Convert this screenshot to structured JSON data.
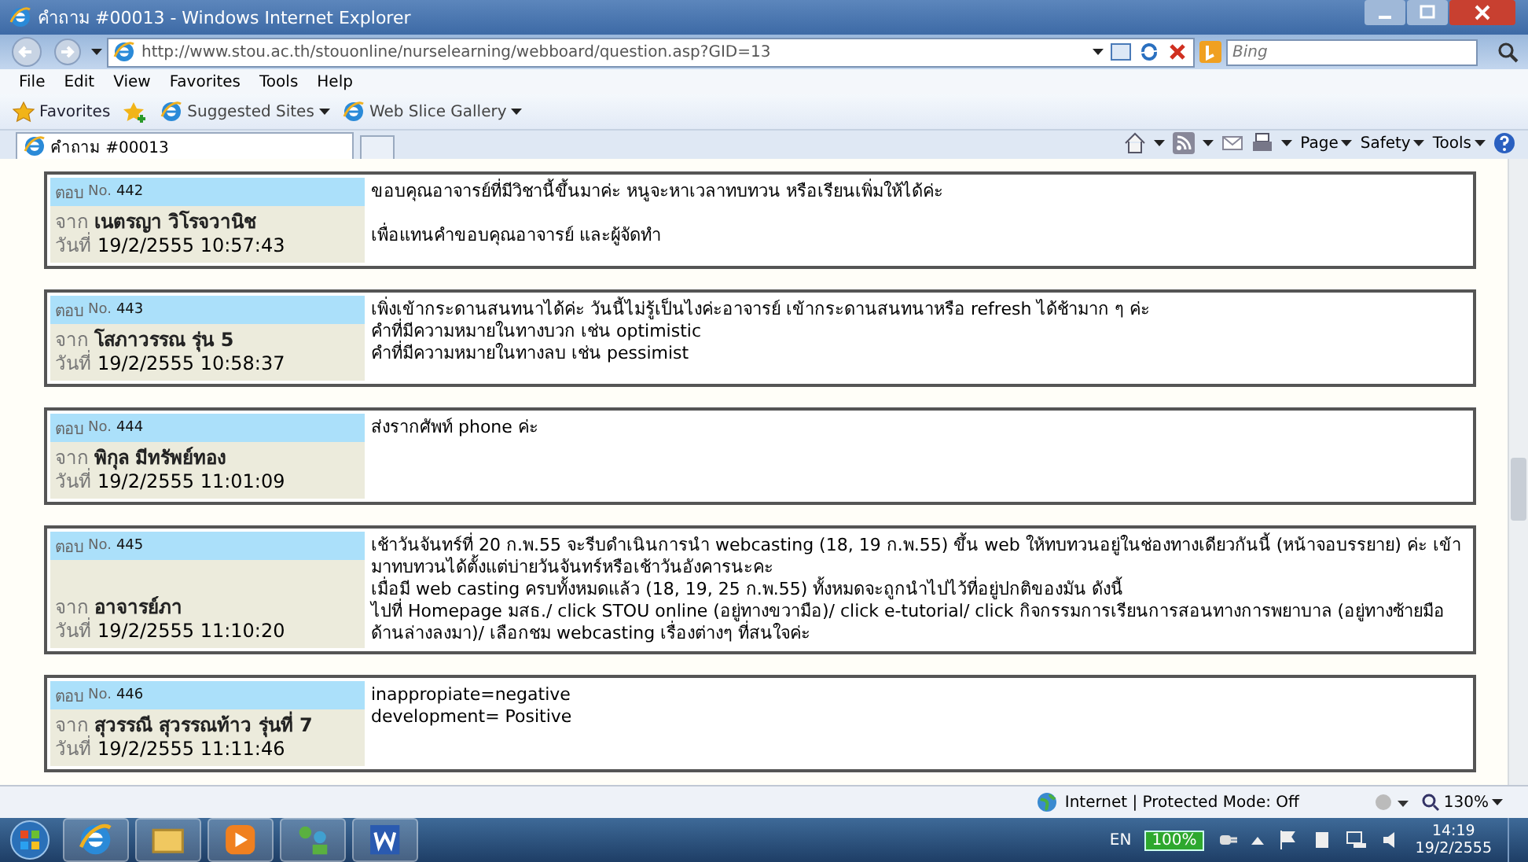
{
  "window": {
    "title": "คำถาม #00013 - Windows Internet Explorer"
  },
  "address_bar": {
    "url": "http://www.stou.ac.th/stouonline/nurselearning/webboard/question.asp?GID=13",
    "search_placeholder": "Bing"
  },
  "menu": [
    "File",
    "Edit",
    "View",
    "Favorites",
    "Tools",
    "Help"
  ],
  "favorites_bar": [
    {
      "label": "Favorites",
      "kind": "star"
    },
    {
      "label": "Suggested Sites",
      "kind": "dropdown"
    },
    {
      "label": "Web Slice Gallery",
      "kind": "dropdown"
    }
  ],
  "tabs": [
    {
      "label": "คำถาม #00013",
      "selected": true
    }
  ],
  "command_bar": [
    "Page",
    "Safety",
    "Tools"
  ],
  "posts": [
    {
      "reply_label": "ตอบ",
      "no_label": "No.",
      "number": "442",
      "from_label": "จาก",
      "author": "เนตรญา วิโรจวานิช",
      "date_label": "วันที่",
      "date": "19/2/2555 10:57:43",
      "spaced": true,
      "lines": [
        "ขอบคุณอาจารย์ที่มีวิชานี้ขึ้นมาค่ะ หนูจะหาเวลาทบทวน หรือเรียนเพิ่มให้ได้ค่ะ",
        "เพื่อแทนคำขอบคุณอาจารย์ และผู้จัดทำ"
      ]
    },
    {
      "reply_label": "ตอบ",
      "no_label": "No.",
      "number": "443",
      "from_label": "จาก",
      "author": "โสภาวรรณ รุ่น 5",
      "date_label": "วันที่",
      "date": "19/2/2555 10:58:37",
      "lines": [
        "เพิ่งเข้ากระดานสนทนาได้ค่ะ วันนี้ไม่รู้เป็นไงค่ะอาจารย์ เข้ากระดานสนทนาหรือ refresh ได้ช้ามาก ๆ ค่ะ",
        "คำที่มีความหมายในทางบวก เช่น optimistic",
        "คำที่มีความหมายในทางลบ เช่น pessimist"
      ]
    },
    {
      "reply_label": "ตอบ",
      "no_label": "No.",
      "number": "444",
      "from_label": "จาก",
      "author": "พิกุล มีทรัพย์ทอง",
      "date_label": "วันที่",
      "date": "19/2/2555 11:01:09",
      "lines": [
        "ส่งรากศัพท์ phone ค่ะ"
      ]
    },
    {
      "reply_label": "ตอบ",
      "no_label": "No.",
      "number": "445",
      "from_label": "จาก",
      "author": "อาจารย์ภา",
      "date_label": "วันที่",
      "date": "19/2/2555 11:10:20",
      "lines": [
        "เช้าวันจันทร์ที่ 20 ก.พ.55 จะรีบดำเนินการนำ webcasting (18, 19 ก.พ.55) ขึ้น web ให้ทบทวนอยู่ในช่องทางเดียวกันนี้ (หน้าจอบรรยาย) ค่ะ เข้ามาทบทวนได้ตั้งแต่บ่ายวันจันทร์หรือเช้าวันอังคารนะคะ",
        "เมื่อมี web casting ครบทั้งหมดแล้ว (18, 19, 25 ก.พ.55) ทั้งหมดจะถูกนำไปไว้ที่อยู่ปกติของมัน ดังนี้",
        "ไปที่ Homepage มสธ./ click STOU online (อยู่ทางขวามือ)/ click e-tutorial/ click กิจกรรมการเรียนการสอนทางการพยาบาล (อยู่ทางซ้ายมือด้านล่างลงมา)/ เลือกชม webcasting เรื่องต่างๆ ที่สนใจค่ะ"
      ]
    },
    {
      "reply_label": "ตอบ",
      "no_label": "No.",
      "number": "446",
      "from_label": "จาก",
      "author": "สุวรรณี สุวรรณท้าว รุ่นที่ 7",
      "date_label": "วันที่",
      "date": "19/2/2555 11:11:46",
      "lines": [
        "inappropiate=negative",
        "development= Positive"
      ]
    }
  ],
  "status_bar": {
    "zone": "Internet | Protected Mode: Off",
    "zoom": "130%"
  },
  "taskbar": {
    "language": "EN",
    "battery": "100%",
    "time": "14:19",
    "date": "19/2/2555"
  }
}
